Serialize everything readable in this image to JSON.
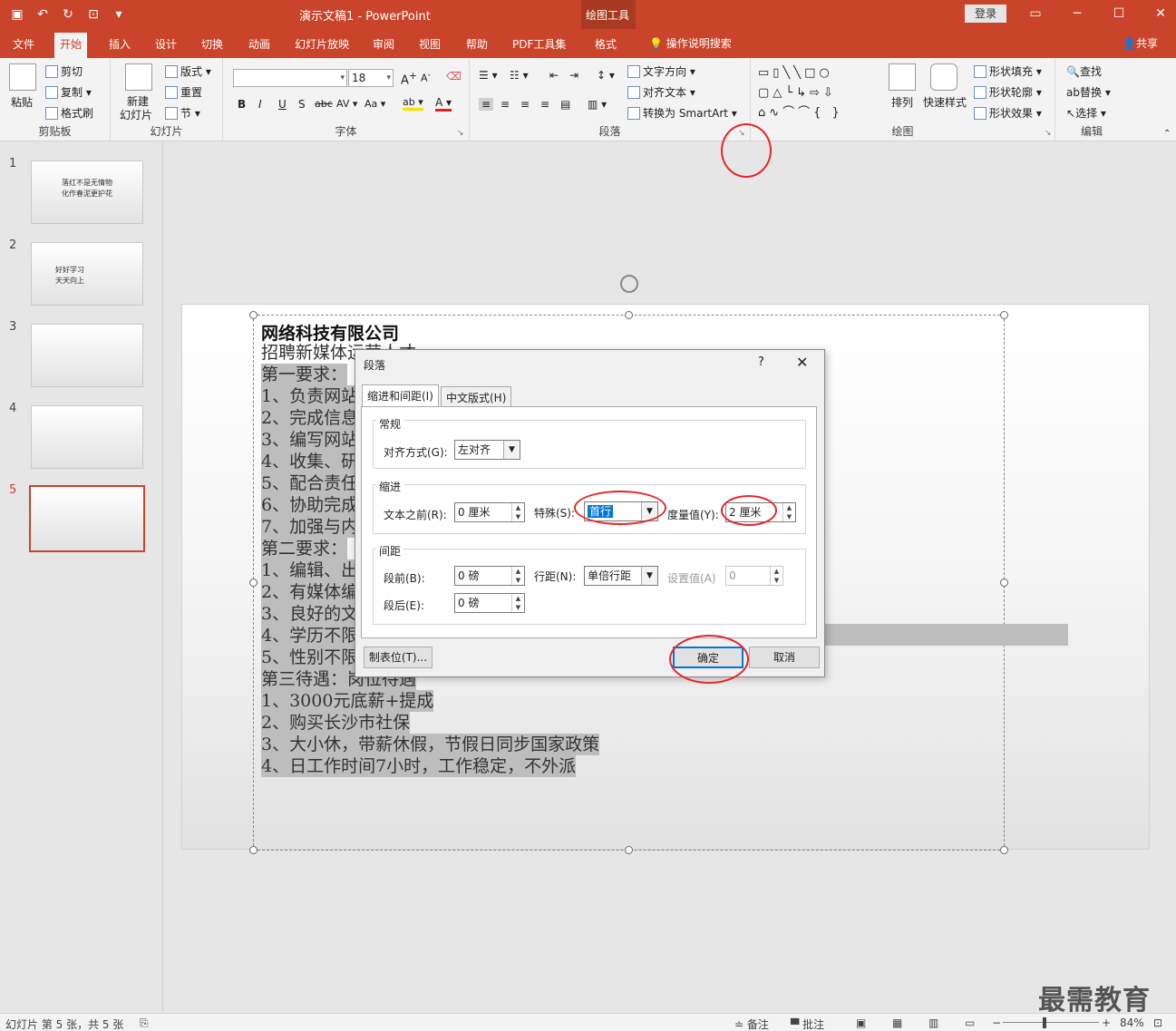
{
  "titlebar": {
    "doc_title": "演示文稿1 - PowerPoint",
    "tools_label": "绘图工具",
    "login": "登录"
  },
  "tabs": [
    "文件",
    "开始",
    "插入",
    "设计",
    "切换",
    "动画",
    "幻灯片放映",
    "审阅",
    "视图",
    "帮助",
    "PDF工具集",
    "格式"
  ],
  "search_tab": "操作说明搜索",
  "share": "共享",
  "ribbon": {
    "clipboard": {
      "label": "剪贴板",
      "paste": "粘贴",
      "cut": "剪切",
      "copy": "复制",
      "format_painter": "格式刷"
    },
    "slides": {
      "label": "幻灯片",
      "new_slide_1": "新建",
      "new_slide_2": "幻灯片",
      "layout": "版式",
      "reset": "重置",
      "section": "节"
    },
    "font": {
      "label": "字体",
      "font_name": "",
      "font_size": "18"
    },
    "paragraph": {
      "label": "段落",
      "text_direction": "文字方向",
      "align_text": "对齐文本",
      "smartart": "转换为 SmartArt"
    },
    "drawing": {
      "label": "绘图",
      "arrange": "排列",
      "quick_styles": "快速样式",
      "shape_fill": "形状填充",
      "shape_outline": "形状轮廓",
      "shape_effects": "形状效果"
    },
    "editing": {
      "label": "编辑",
      "find": "查找",
      "replace": "替换",
      "select": "选择"
    }
  },
  "thumbnails": [
    {
      "num": "1",
      "lines": [
        "落红不是无情物",
        "化作春泥更护花"
      ]
    },
    {
      "num": "2",
      "lines": [
        "好好学习",
        "天天向上"
      ]
    },
    {
      "num": "3",
      "lines": [
        ""
      ]
    },
    {
      "num": "4",
      "lines": [
        ""
      ]
    },
    {
      "num": "5",
      "lines": [
        ""
      ]
    }
  ],
  "slide": {
    "heading": "网络科技有限公司",
    "lines": [
      "招聘新媒体运营人才",
      "第一要求：",
      "1、负责网站",
      "2、完成信息",
      "3、编写网站",
      "4、收集、研",
      "5、配合责任",
      "6、协助完成",
      "7、加强与内",
      "第二要求：",
      "1、编辑、出",
      "2、有媒体编",
      "3、良好的文",
      "4、学历不限",
      "5、性别不限",
      "第三待遇：岗位待遇",
      "1、3000元底薪+提成",
      "2、购买长沙市社保",
      "3、大小休，带薪休假，节假日同步国家政策",
      "4、日工作时间7小时，工作稳定，不外派"
    ]
  },
  "dialog": {
    "title": "段落",
    "help": "?",
    "close": "✕",
    "tab_indent": "缩进和间距(I)",
    "tab_chinese": "中文版式(H)",
    "general_legend": "常规",
    "alignment_label": "对齐方式(G):",
    "alignment_value": "左对齐",
    "indent_legend": "缩进",
    "before_text_label": "文本之前(R):",
    "before_text_value": "0 厘米",
    "special_label": "特殊(S):",
    "special_value": "首行",
    "by_label": "度量值(Y):",
    "by_value": "2 厘米",
    "spacing_legend": "间距",
    "before_label": "段前(B):",
    "before_value": "0 磅",
    "after_label": "段后(E):",
    "after_value": "0 磅",
    "line_spacing_label": "行距(N):",
    "line_spacing_value": "单倍行距",
    "at_label": "设置值(A)",
    "at_value": "0",
    "tabs_button": "制表位(T)...",
    "ok_button": "确定",
    "cancel_button": "取消"
  },
  "statusbar": {
    "slide_info": "幻灯片 第 5 张，共 5 张",
    "notes": "备注",
    "comments": "批注",
    "zoom": "84%"
  },
  "watermark": "最需教育"
}
